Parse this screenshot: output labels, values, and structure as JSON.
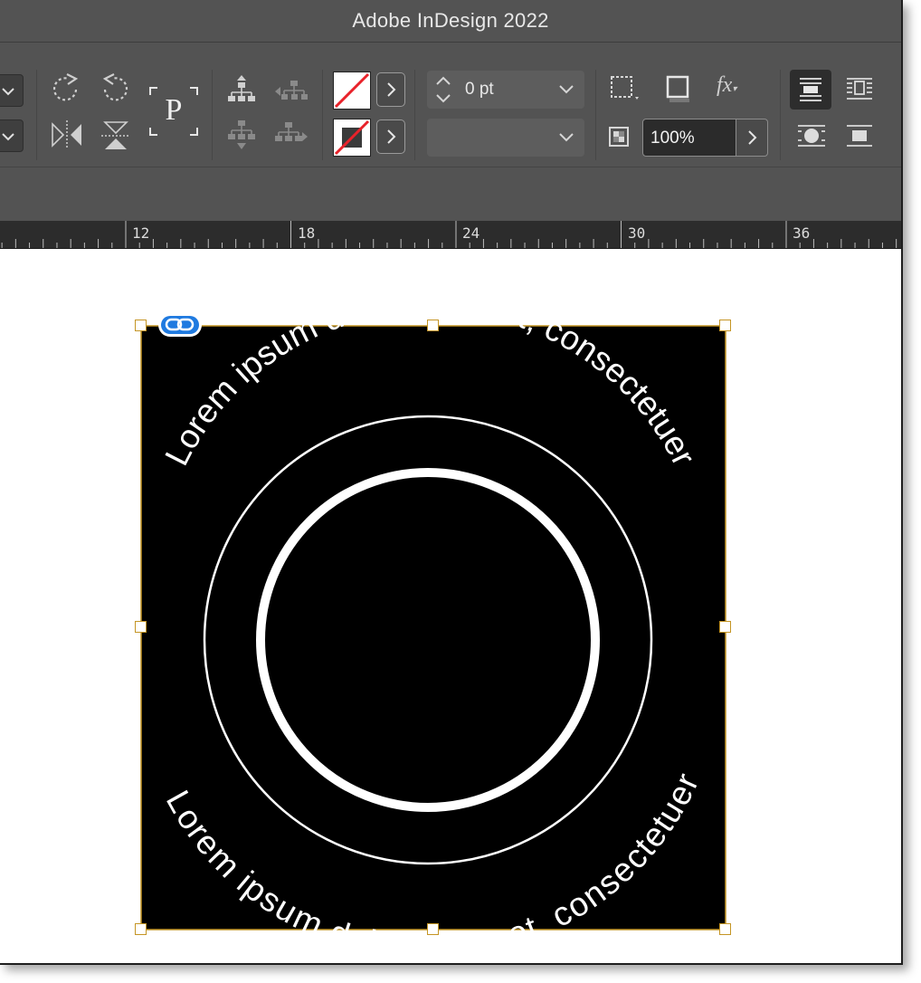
{
  "window": {
    "title": "Adobe InDesign 2022"
  },
  "toolbar": {
    "stroke_weight": {
      "value": "0 pt"
    },
    "opacity": {
      "value": "100%"
    },
    "style_dropdown": {
      "value": ""
    },
    "fx_label": "fx",
    "proxy_letter": "P"
  },
  "ruler": {
    "labels": [
      "12",
      "18",
      "24",
      "30",
      "36"
    ]
  },
  "document": {
    "frame_fill": "#000000",
    "selection_color": "#c49524",
    "top_text": "Lorem ipsum dolor sit amet, consectetuer",
    "bottom_text": "Lorem ipsum dolor sit amet, consectetuer",
    "link_badge_color": "#1f7ae0"
  },
  "colors": {
    "app_chrome": "#535353",
    "ruler": "#2c2c2c",
    "none_slash": "#e8222a"
  }
}
